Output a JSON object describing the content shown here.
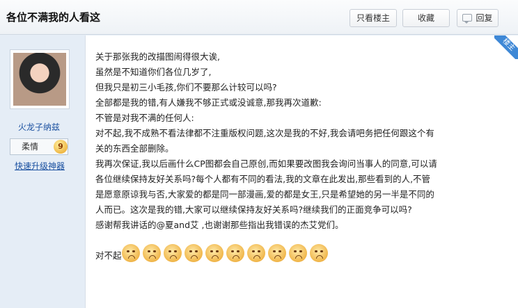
{
  "header": {
    "title": "各位不满我的人看这",
    "buttons": {
      "author_only": "只看楼主",
      "favorite": "收藏",
      "reply": "回复"
    }
  },
  "author": {
    "username": "火龙子纳兹",
    "level_name": "柔情",
    "level_number": "9",
    "upgrade_link": "快速升级神器",
    "role_badge": "楼主"
  },
  "post": {
    "lines": [
      "关于那张我的改描图闹得很大诶,",
      "虽然是不知道你们各位几岁了,",
      "但我只是初三小毛孩,你们不要那么计较可以吗?",
      "全部都是我的错,有人嫌我不够正式或没诚意,那我再次道歉:",
      "不管是对我不满的任何人:",
      "对不起,我不成熟不看法律都不注重版权问题,这次是我的不好,我会请吧务把任何跟这个有",
      "关的东西全部删除。",
      "我再次保证,我以后画什么CP图都会自己原创,而如果要改图我会询问当事人的同意,可以请",
      "各位继续保持友好关系吗?每个人都有不同的看法,我的文章在此发出,那些看到的人,不管",
      "是愿意原谅我与否,大家爱的都是同一部漫画,爱的都是女王,只是希望她的另一半是不同的",
      "人而已。这次是我的错,大家可以继续保持友好关系吗?继续我们的正面竞争可以吗?",
      "感谢帮我讲话的@夏and艾 ,也谢谢那些指出我错误的杰艾党们。"
    ],
    "closing_text": "对不起",
    "emoticon_count": 10,
    "emoticon_icon": "sad-face-emoticon"
  }
}
